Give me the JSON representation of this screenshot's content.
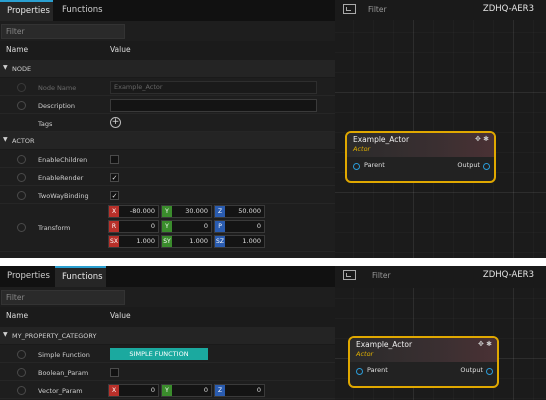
{
  "panel1": {
    "tabs": [
      {
        "label": "Properties",
        "active": true
      },
      {
        "label": "Functions",
        "active": false
      }
    ],
    "filter_placeholder": "Filter",
    "columns": {
      "name": "Name",
      "value": "Value"
    },
    "categories": {
      "node": {
        "label": "NODE"
      },
      "actor": {
        "label": "ACTOR"
      }
    },
    "node_props": {
      "node_name": {
        "label": "Node Name",
        "value": "Example_Actor"
      },
      "description": {
        "label": "Description",
        "value": ""
      },
      "tags": {
        "label": "Tags"
      }
    },
    "actor_props": {
      "enable_children": {
        "label": "EnableChildren",
        "checked": false
      },
      "enable_render": {
        "label": "EnableRender",
        "checked": true
      },
      "two_way_binding": {
        "label": "TwoWayBinding",
        "checked": true
      },
      "transform": {
        "label": "Transform",
        "rows": [
          [
            {
              "tag": "X",
              "value": "-80.000"
            },
            {
              "tag": "Y",
              "value": "30.000"
            },
            {
              "tag": "Z",
              "value": "50.000"
            }
          ],
          [
            {
              "tag": "R",
              "value": "0"
            },
            {
              "tag": "Y",
              "value": "0"
            },
            {
              "tag": "P",
              "value": "0"
            }
          ],
          [
            {
              "tag": "SX",
              "value": "1.000"
            },
            {
              "tag": "SY",
              "value": "1.000"
            },
            {
              "tag": "SZ",
              "value": "1.000"
            }
          ]
        ]
      }
    },
    "graph": {
      "filter_placeholder": "Filter",
      "title": "ZDHQ-AER3",
      "node": {
        "title": "Example_Actor",
        "type": "Actor",
        "input": "Parent",
        "output": "Output"
      }
    }
  },
  "panel2": {
    "tabs": [
      {
        "label": "Properties",
        "active": false
      },
      {
        "label": "Functions",
        "active": true
      }
    ],
    "filter_placeholder": "Filter",
    "columns": {
      "name": "Name",
      "value": "Value"
    },
    "category": {
      "label": "MY_PROPERTY_CATEGORY"
    },
    "props": {
      "simple_function": {
        "label": "Simple Function",
        "button": "SIMPLE FUNCTION"
      },
      "boolean_param": {
        "label": "Boolean_Param",
        "checked": false
      },
      "vector_param": {
        "label": "Vector_Param",
        "x": "0",
        "y": "0",
        "z": "0"
      }
    },
    "graph": {
      "filter_placeholder": "Filter",
      "title": "ZDHQ-AER3",
      "node": {
        "title": "Example_Actor",
        "type": "Actor",
        "input": "Parent",
        "output": "Output"
      }
    }
  },
  "colors": {
    "accent": "#2a9fd0",
    "node_border": "#e0a800",
    "pin": "#2b9cd8",
    "function_button": "#1ba99f",
    "tag_red": "#b8302a",
    "tag_green": "#3a8c2c",
    "tag_blue": "#2a5cb0"
  },
  "icons": [
    "chevron-down-icon",
    "plus-circle-icon",
    "checkmark-icon",
    "graph-view-icon",
    "move-icon",
    "gear-icon",
    "pin-icon"
  ]
}
